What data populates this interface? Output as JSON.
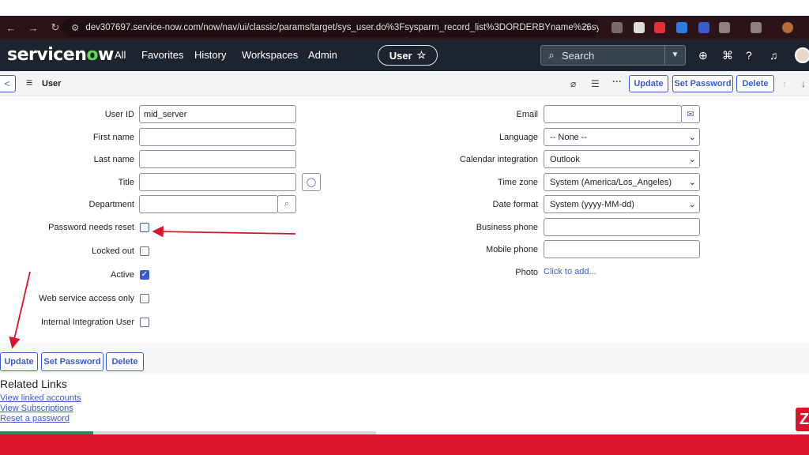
{
  "browser": {
    "url": "dev307697.service-now.com/now/nav/ui/classic/params/target/sys_user.do%3Fsysparm_record_list%3DORDERBYname%26sysparm_r..."
  },
  "header": {
    "logo_prefix": "servicen",
    "logo_o": "o",
    "logo_suffix": "w",
    "nav": [
      "All",
      "Favorites",
      "History",
      "Workspaces",
      "Admin"
    ],
    "context_pill": "User",
    "search_placeholder": "Search"
  },
  "form_bar": {
    "title": "User",
    "update_label": "Update",
    "set_password_label": "Set Password",
    "delete_label": "Delete"
  },
  "left_fields": {
    "user_id": {
      "label": "User ID",
      "value": "mid_server"
    },
    "first_name": {
      "label": "First name",
      "value": ""
    },
    "last_name": {
      "label": "Last name",
      "value": ""
    },
    "title": {
      "label": "Title",
      "value": ""
    },
    "department": {
      "label": "Department",
      "value": ""
    },
    "password_needs_reset": {
      "label": "Password needs reset",
      "checked": false
    },
    "locked_out": {
      "label": "Locked out",
      "checked": false
    },
    "active": {
      "label": "Active",
      "checked": true
    },
    "web_service_access_only": {
      "label": "Web service access only",
      "checked": false
    },
    "internal_integration_user": {
      "label": "Internal Integration User",
      "checked": false
    }
  },
  "right_fields": {
    "email": {
      "label": "Email",
      "value": ""
    },
    "language": {
      "label": "Language",
      "value": "-- None --"
    },
    "calendar_integration": {
      "label": "Calendar integration",
      "value": "Outlook"
    },
    "time_zone": {
      "label": "Time zone",
      "value": "System (America/Los_Angeles)"
    },
    "date_format": {
      "label": "Date format",
      "value": "System (yyyy-MM-dd)"
    },
    "business_phone": {
      "label": "Business phone",
      "value": ""
    },
    "mobile_phone": {
      "label": "Mobile phone",
      "value": ""
    },
    "photo": {
      "label": "Photo",
      "link": "Click to add..."
    }
  },
  "bottom_buttons": {
    "update_label": "Update",
    "set_password_label": "Set Password",
    "delete_label": "Delete"
  },
  "related_links": {
    "title": "Related Links",
    "links": [
      "View linked accounts",
      "View Subscriptions",
      "Reset a password"
    ]
  },
  "badge": "Z",
  "colors": {
    "header_bg": "#1d2430",
    "accent": "#3b5ccc",
    "annotation_arrow": "#d8152a",
    "footer_red": "#d8152a"
  }
}
